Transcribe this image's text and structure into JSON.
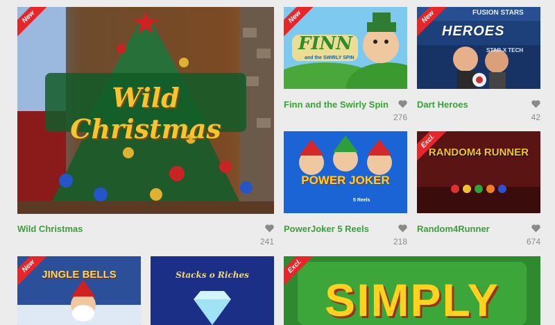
{
  "games": [
    {
      "id": "wild-christmas",
      "name": "Wild Christmas",
      "likes": "241",
      "badge": "New",
      "art_title": "Wild Christmas"
    },
    {
      "id": "finn",
      "name": "Finn and the Swirly Spin",
      "likes": "276",
      "badge": "New",
      "art_title": "FINN",
      "art_sub": "and the SWIRLY SPIN"
    },
    {
      "id": "dart-heroes",
      "name": "Dart Heroes",
      "likes": "42",
      "badge": "New",
      "art_title": "HEROES",
      "art_top": "FUSION STARS",
      "art_sub": "STAR-X TECH"
    },
    {
      "id": "powerjoker",
      "name": "PowerJoker 5 Reels",
      "likes": "218",
      "badge": "",
      "art_title": "POWER JOKER",
      "art_sub": "5 Reels"
    },
    {
      "id": "random4runner",
      "name": "Random4Runner",
      "likes": "674",
      "badge": "Excl.",
      "art_title": "RANDOM4 RUNNER"
    },
    {
      "id": "jingle-bells",
      "name": "",
      "likes": "",
      "badge": "New",
      "art_title": "JINGLE BELLS"
    },
    {
      "id": "stacks-riches",
      "name": "",
      "likes": "",
      "badge": "",
      "art_title": "Stacks o Riches"
    },
    {
      "id": "simply",
      "name": "",
      "likes": "",
      "badge": "Excl.",
      "art_title": "SIMPLY"
    }
  ],
  "colors": {
    "accent": "#3aa138",
    "badge": "#e8262a",
    "likes": "#8a8a8a",
    "background": "#ececec"
  }
}
